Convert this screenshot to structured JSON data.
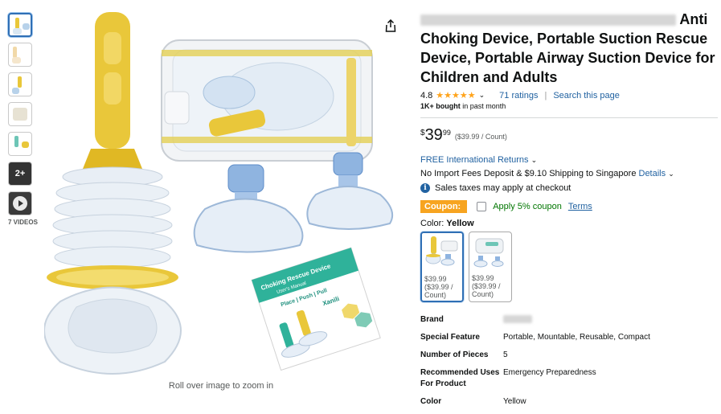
{
  "thumbnails": [
    {
      "name": "thumb-1"
    },
    {
      "name": "thumb-2"
    },
    {
      "name": "thumb-3"
    },
    {
      "name": "thumb-4"
    },
    {
      "name": "thumb-5"
    }
  ],
  "more_thumbs_label": "2+",
  "videos_label": "7 VIDEOS",
  "zoom_hint": "Roll over image to zoom in",
  "product": {
    "title_line1_end": "Anti",
    "title_line2": "Choking Device, Portable Suction Rescue",
    "title_line3": "Device, Portable Airway Suction Device for",
    "title_line4": "Children and Adults",
    "rating": "4.8",
    "stars": "★★★★★",
    "ratings_count": "71 ratings",
    "search_link": "Search this page",
    "bought_bold": "1K+ bought",
    "bought_rest": " in past month"
  },
  "price": {
    "symbol": "$",
    "whole": "39",
    "fraction": "99",
    "unit": "($39.99 / Count)"
  },
  "shipping": {
    "returns": "FREE International Returns",
    "fees": "No Import Fees Deposit & $9.10 Shipping to Singapore",
    "details": "Details",
    "tax": "Sales taxes may apply at checkout"
  },
  "coupon": {
    "badge": "Coupon:",
    "text": "Apply 5% coupon",
    "terms": "Terms"
  },
  "color": {
    "label": "Color:",
    "value": "Yellow",
    "options": [
      {
        "name": "Yellow",
        "price": "$39.99",
        "unit": "($39.99 / Count)"
      },
      {
        "name": "Blue",
        "price": "$39.99",
        "unit": "($39.99 / Count)"
      }
    ]
  },
  "specs": [
    {
      "key": "Brand",
      "value": ""
    },
    {
      "key": "Special Feature",
      "value": "Portable, Mountable, Reusable, Compact"
    },
    {
      "key": "Number of Pieces",
      "value": "5"
    },
    {
      "key": "Recommended Uses For Product",
      "value": "Emergency Preparedness"
    },
    {
      "key": "Color",
      "value": "Yellow"
    }
  ],
  "manual": {
    "title": "Choking Rescue Device",
    "subtitle": "User's Manual",
    "steps": "Place | Push | Pull",
    "brand": "Xanili"
  },
  "colors": {
    "link": "#2162a1",
    "star": "#ffa41c",
    "coupon_badge": "#f7a420",
    "device_yellow": "#e9c73a",
    "mask_blue": "#6f9ed3"
  }
}
